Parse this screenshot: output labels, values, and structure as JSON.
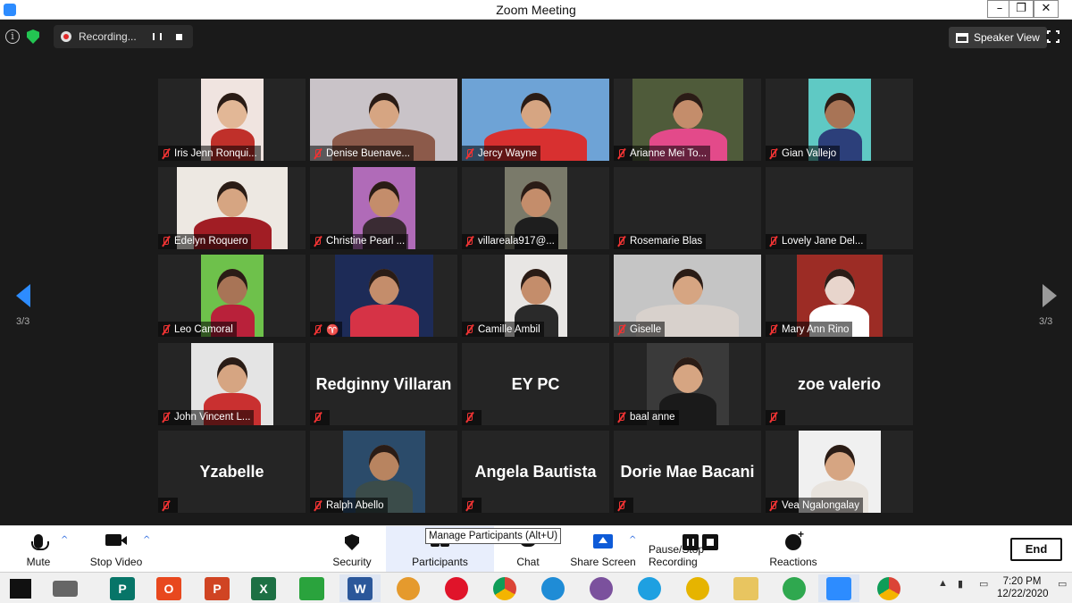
{
  "window": {
    "title": "Zoom Meeting",
    "buttons": [
      "–",
      "❐",
      "✕"
    ]
  },
  "topbar": {
    "recording_text": "Recording...",
    "speaker_view_label": "Speaker View"
  },
  "pagination": {
    "left": "3/3",
    "right": "3/3"
  },
  "participants": [
    {
      "name": "Iris Jenn Ronqui...",
      "video": true
    },
    {
      "name": "Denise Buenave...",
      "video": true
    },
    {
      "name": "Jercy Wayne",
      "video": true
    },
    {
      "name": "Arianne Mei To...",
      "video": true
    },
    {
      "name": "Gian Vallejo",
      "video": true
    },
    {
      "name": "Edelyn Roquero",
      "video": true
    },
    {
      "name": "Christine Pearl ...",
      "video": true
    },
    {
      "name": "villareala917@...",
      "video": true
    },
    {
      "name": "Rosemarie Blas",
      "video": false,
      "display": ""
    },
    {
      "name": "Lovely Jane Del...",
      "video": false,
      "display": ""
    },
    {
      "name": "Leo Camoral",
      "video": true
    },
    {
      "name": "♈",
      "video": true
    },
    {
      "name": "Camille Ambil",
      "video": true
    },
    {
      "name": "Giselle",
      "video": true
    },
    {
      "name": "Mary Ann Rino",
      "video": true
    },
    {
      "name": "John Vincent L...",
      "video": true
    },
    {
      "name": "",
      "video": false,
      "display": "Redginny Villaran"
    },
    {
      "name": "",
      "video": false,
      "display": "EY PC"
    },
    {
      "name": "baal anne",
      "video": true
    },
    {
      "name": "",
      "video": false,
      "display": "zoe valerio"
    },
    {
      "name": "",
      "video": false,
      "display": "Yzabelle"
    },
    {
      "name": "Ralph Abello",
      "video": true
    },
    {
      "name": "",
      "video": false,
      "display": "Angela Bautista"
    },
    {
      "name": "",
      "video": false,
      "display": "Dorie Mae Bacani"
    },
    {
      "name": "Vea Ngalongalay",
      "video": true
    }
  ],
  "toolbar": {
    "mute": "Mute",
    "stop_video": "Stop Video",
    "security": "Security",
    "participants": "Participants",
    "chat": "Chat",
    "share_screen": "Share Screen",
    "pause_stop_recording": "Pause/Stop Recording",
    "reactions": "Reactions",
    "end": "End",
    "tooltip": "Manage Participants (Alt+U)"
  },
  "taskbar": {
    "time": "7:20 PM",
    "date": "12/22/2020"
  },
  "colors": {
    "accent": "#2d8cff",
    "muted_red": "#e33333",
    "tile_bg": "#252525"
  }
}
